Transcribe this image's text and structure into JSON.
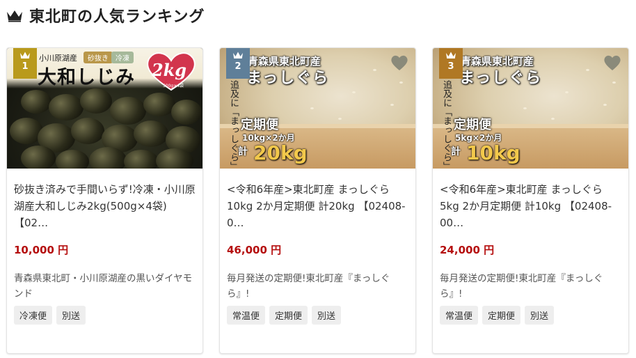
{
  "section": {
    "title": "東北町の人気ランキング",
    "icon": "crown-icon"
  },
  "colors": {
    "price": "#b50e0e",
    "rank1": "#b99a1c",
    "rank2": "#5f7f99",
    "rank3": "#b07824"
  },
  "cards": [
    {
      "rank": "1",
      "title": "砂抜き済みで手間いらず!冷凍・小川原湖産大和しじみ2kg(500g×4袋) 【02…",
      "price": "10,000 円",
      "description": "青森県東北町・小川原湖産の黒いダイヤモンド",
      "tags": [
        "冷凍便",
        "別送"
      ],
      "image": {
        "origin": "小川原湖産",
        "tag1": "砂抜き",
        "tag2": "冷凍",
        "product": "大和しじみ",
        "weight": "2kg",
        "weight_note": "500g×4袋"
      }
    },
    {
      "rank": "2",
      "title": "<令和6年産>東北町産 まっしぐら 10kg 2か月定期便 計20kg 【02408-0…",
      "price": "46,000 円",
      "description": "毎月発送の定期便!東北町産『まっしぐら』!",
      "tags": [
        "常温便",
        "定期便",
        "別送"
      ],
      "image": {
        "origin": "青森県東北町産",
        "brand": "まっしぐら",
        "vertical": "追及に「まっしぐら」",
        "teiki": "定期便",
        "spec": "10kg×2か月",
        "total_label": "計",
        "total": "20kg"
      }
    },
    {
      "rank": "3",
      "title": "<令和6年産>東北町産 まっしぐら 5kg 2か月定期便 計10kg 【02408-00…",
      "price": "24,000 円",
      "description": "毎月発送の定期便!東北町産『まっしぐら』!",
      "tags": [
        "常温便",
        "定期便",
        "別送"
      ],
      "image": {
        "origin": "青森県東北町産",
        "brand": "まっしぐら",
        "vertical": "追及に「まっしぐら」",
        "teiki": "定期便",
        "spec": "5kg×2か月",
        "total_label": "計",
        "total": "10kg"
      }
    }
  ]
}
